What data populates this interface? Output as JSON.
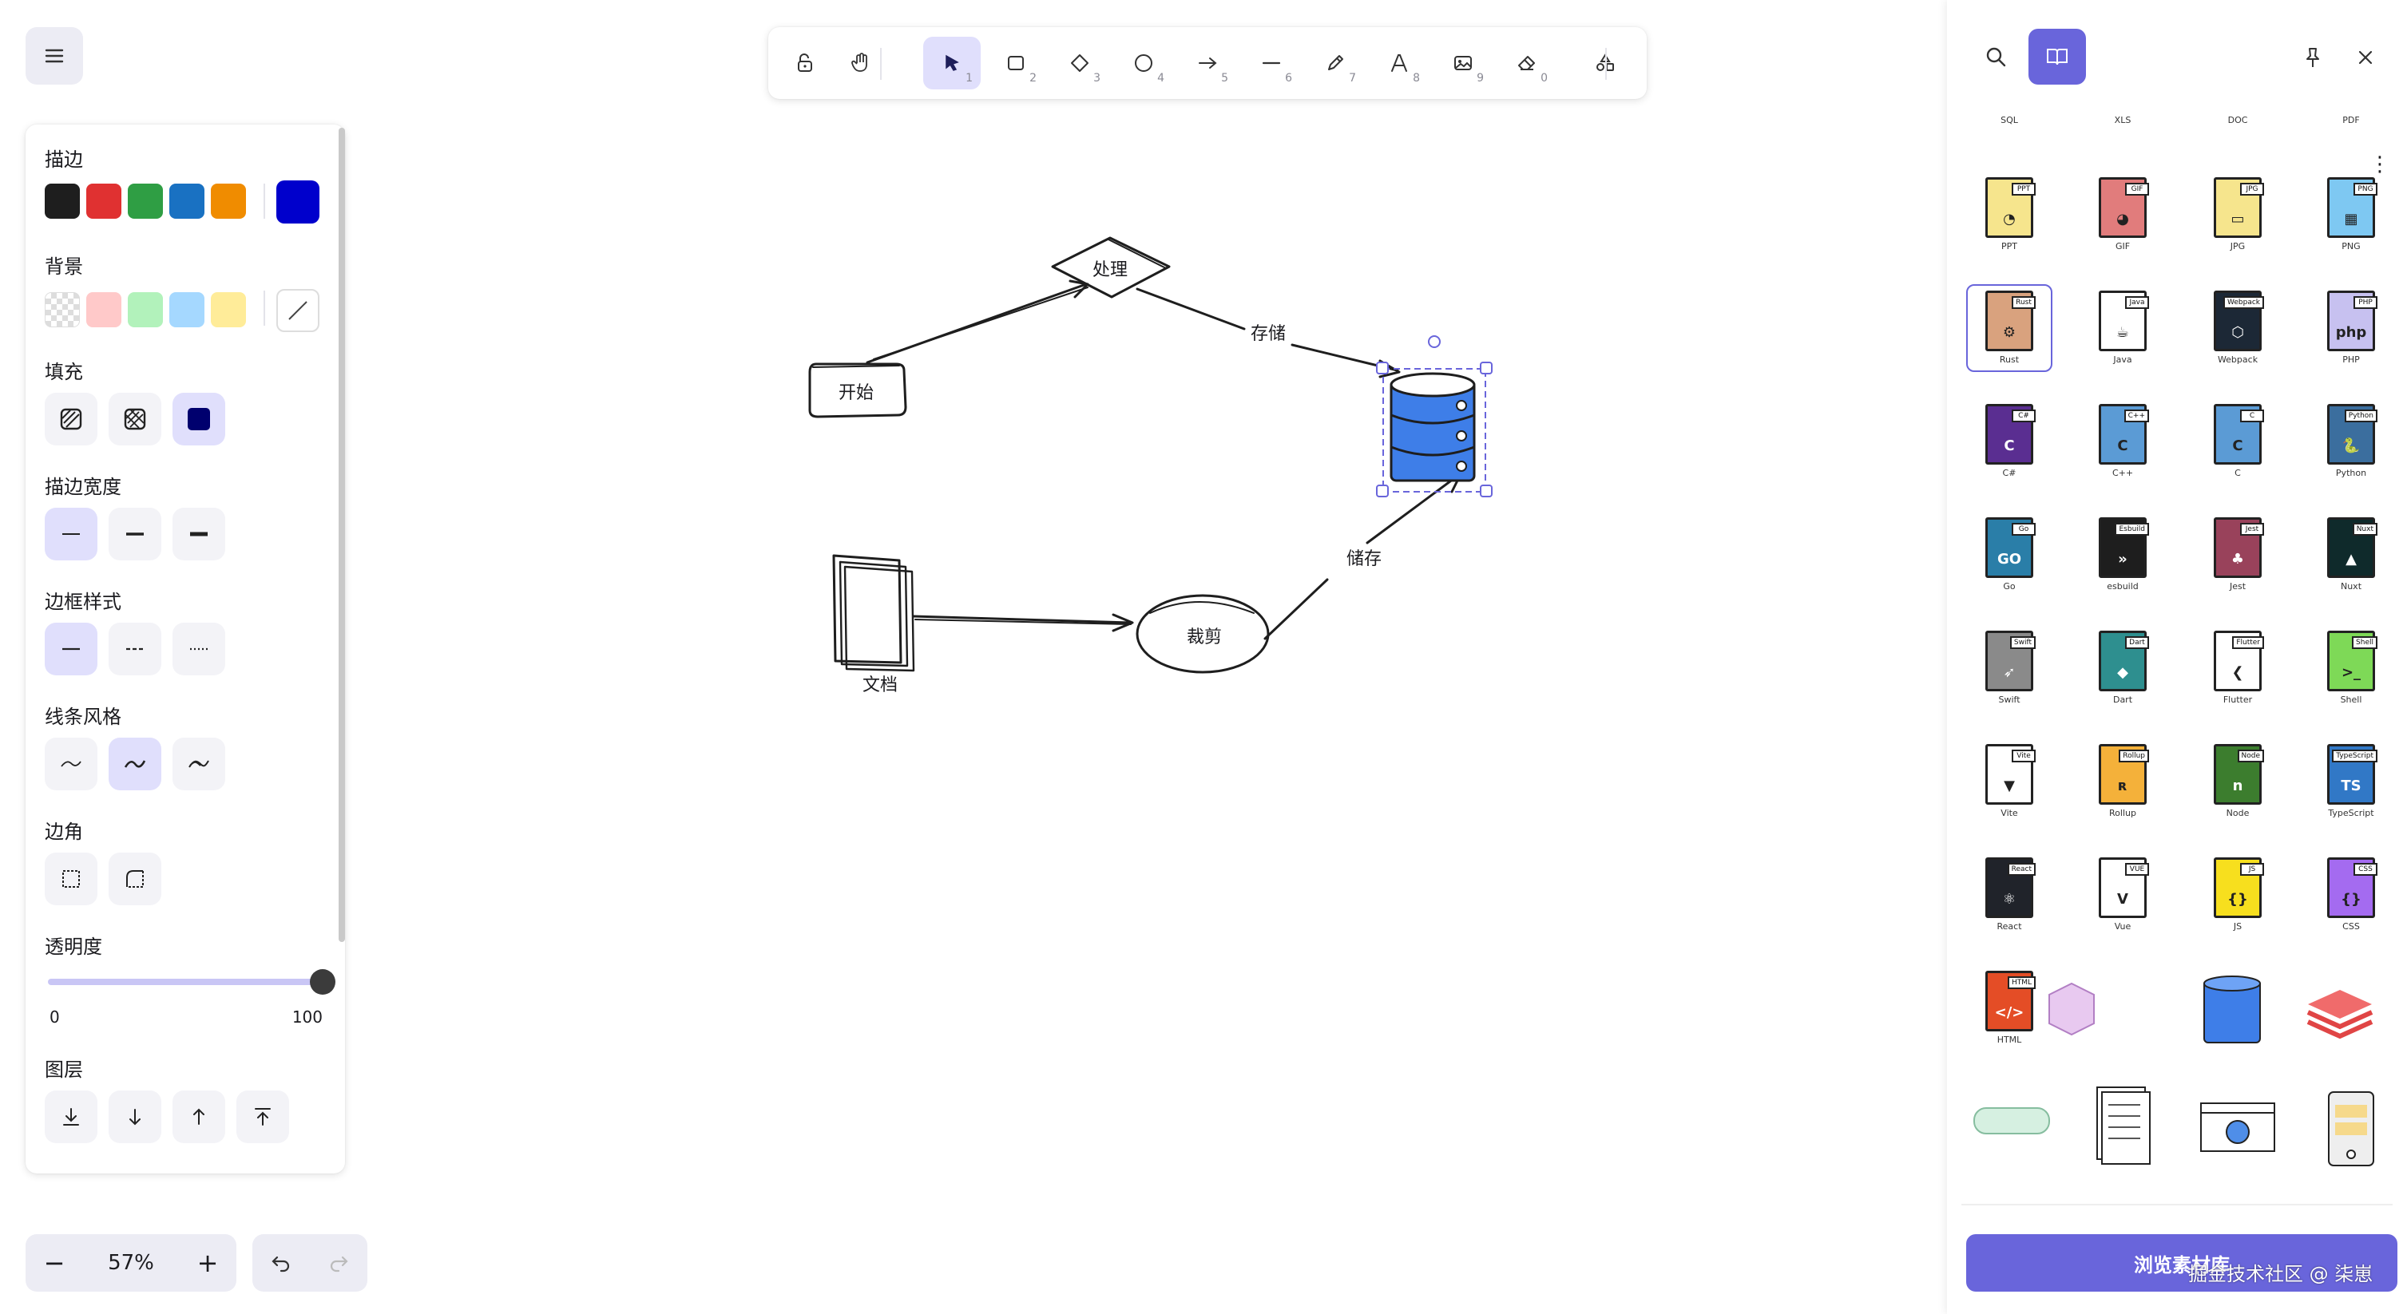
{
  "colors": {
    "accent": "#6965db",
    "selected_bg": "#e0dffc",
    "stroke_swatches": [
      "#1e1e1e",
      "#e03131",
      "#2f9e44",
      "#1971c2",
      "#f08c00"
    ],
    "stroke_current": "#0000cc",
    "bg_swatches": [
      "transparent",
      "#ffc9c9",
      "#b2f2bb",
      "#a5d8ff",
      "#ffec99"
    ],
    "fill_current": "#00006e"
  },
  "properties": {
    "stroke_label": "描边",
    "background_label": "背景",
    "fill_label": "填充",
    "stroke_width_label": "描边宽度",
    "stroke_style_label": "边框样式",
    "sloppiness_label": "线条风格",
    "edges_label": "边角",
    "opacity_label": "透明度",
    "opacity_min": "0",
    "opacity_max": "100",
    "opacity_value": 100,
    "layers_label": "图层"
  },
  "toolbar": {
    "tools": [
      {
        "name": "lock-icon",
        "key": ""
      },
      {
        "name": "hand-icon",
        "key": ""
      },
      {
        "name": "selection-icon",
        "key": "1"
      },
      {
        "name": "rectangle-icon",
        "key": "2"
      },
      {
        "name": "diamond-icon",
        "key": "3"
      },
      {
        "name": "ellipse-icon",
        "key": "4"
      },
      {
        "name": "arrow-icon",
        "key": "5"
      },
      {
        "name": "line-icon",
        "key": "6"
      },
      {
        "name": "pencil-icon",
        "key": "7"
      },
      {
        "name": "text-icon",
        "key": "8"
      },
      {
        "name": "image-icon",
        "key": "9"
      },
      {
        "name": "eraser-icon",
        "key": "0"
      },
      {
        "name": "shapes-icon",
        "key": ""
      }
    ]
  },
  "canvas": {
    "start": "开始",
    "process": "处理",
    "store_label_top": "存储",
    "store_label_bottom": "储存",
    "crop": "裁剪",
    "document": "文档"
  },
  "zoom": {
    "value": "57%",
    "minus": "−",
    "plus": "+"
  },
  "library": {
    "top_row_labels": [
      "SQL",
      "XLS",
      "DOC",
      "PDF"
    ],
    "items": [
      {
        "tag": "PPT",
        "label": "PPT",
        "color": "#f6e58d",
        "glyph": "◔"
      },
      {
        "tag": "GIF",
        "label": "GIF",
        "color": "#e17c7c",
        "glyph": "◕"
      },
      {
        "tag": "JPG",
        "label": "JPG",
        "color": "#f6e58d",
        "glyph": "▭"
      },
      {
        "tag": "PNG",
        "label": "PNG",
        "color": "#7ec8f2",
        "glyph": "▦"
      },
      {
        "tag": "Rust",
        "label": "Rust",
        "color": "#d9a27e",
        "glyph": "⚙"
      },
      {
        "tag": "Java",
        "label": "Java",
        "color": "#ffffff",
        "glyph": "☕"
      },
      {
        "tag": "Webpack",
        "label": "Webpack",
        "color": "#1c2836",
        "glyph": "⬡"
      },
      {
        "tag": "PHP",
        "label": "PHP",
        "color": "#c7c1f0",
        "glyph": "php"
      },
      {
        "tag": "C#",
        "label": "C#",
        "color": "#5a2e91",
        "glyph": "C"
      },
      {
        "tag": "C++",
        "label": "C++",
        "color": "#5b9bd5",
        "glyph": "C"
      },
      {
        "tag": "C",
        "label": "C",
        "color": "#5b9bd5",
        "glyph": "C"
      },
      {
        "tag": "Python",
        "label": "Python",
        "color": "#3b6e9e",
        "glyph": "🐍"
      },
      {
        "tag": "Go",
        "label": "Go",
        "color": "#2a7ea8",
        "glyph": "GO"
      },
      {
        "tag": "Esbuild",
        "label": "esbuild",
        "color": "#1e1e1e",
        "glyph": "»"
      },
      {
        "tag": "Jest",
        "label": "Jest",
        "color": "#99425b",
        "glyph": "♣"
      },
      {
        "tag": "Nuxt",
        "label": "Nuxt",
        "color": "#0f2a2b",
        "glyph": "▲"
      },
      {
        "tag": "Swift",
        "label": "Swift",
        "color": "#8a8a8a",
        "glyph": "➶"
      },
      {
        "tag": "Dart",
        "label": "Dart",
        "color": "#2e8f8f",
        "glyph": "◆"
      },
      {
        "tag": "Flutter",
        "label": "Flutter",
        "color": "#ffffff",
        "glyph": "❮"
      },
      {
        "tag": "Shell",
        "label": "Shell",
        "color": "#7ed957",
        "glyph": ">_"
      },
      {
        "tag": "Vite",
        "label": "Vite",
        "color": "#ffffff",
        "glyph": "▼"
      },
      {
        "tag": "Rollup",
        "label": "Rollup",
        "color": "#f4b13a",
        "glyph": "ʀ"
      },
      {
        "tag": "Node",
        "label": "Node",
        "color": "#3c7d2e",
        "glyph": "n"
      },
      {
        "tag": "TypeScript",
        "label": "TypeScript",
        "color": "#3178c6",
        "glyph": "TS"
      },
      {
        "tag": "React",
        "label": "React",
        "color": "#20232a",
        "glyph": "⚛"
      },
      {
        "tag": "VUE",
        "label": "Vue",
        "color": "#ffffff",
        "glyph": "V"
      },
      {
        "tag": "JS",
        "label": "JS",
        "color": "#f7df1e",
        "glyph": "{}"
      },
      {
        "tag": "CSS",
        "label": "CSS",
        "color": "#a46bf0",
        "glyph": "{}"
      },
      {
        "tag": "HTML",
        "label": "HTML",
        "color": "#e44d26",
        "glyph": "</>"
      }
    ],
    "browse_button": "浏览素材库",
    "watermark": "掘金技术社区 @ 柒崽"
  }
}
